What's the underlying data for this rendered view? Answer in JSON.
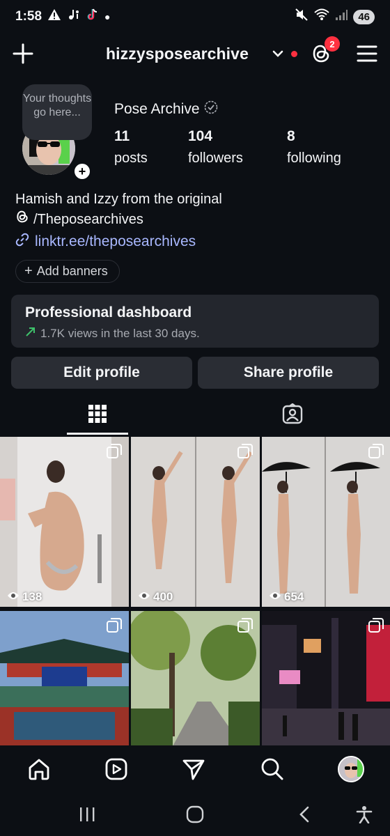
{
  "status_bar": {
    "time": "1:58",
    "battery": "46"
  },
  "header": {
    "username": "hizzysposearchive",
    "notification_count": "2"
  },
  "profile": {
    "thought_bubble": "Your thoughts go here...",
    "display_name": "Pose Archive",
    "stats": [
      {
        "value": "11",
        "label": "posts"
      },
      {
        "value": "104",
        "label": "followers"
      },
      {
        "value": "8",
        "label": "following"
      }
    ],
    "bio_line1": "Hamish and Izzy from the original",
    "bio_line2": "/Theposearchives",
    "link": "linktr.ee/theposearchives",
    "add_banners": "Add banners"
  },
  "dashboard": {
    "title": "Professional dashboard",
    "subtitle": "1.7K views in the last 30 days."
  },
  "buttons": {
    "edit": "Edit profile",
    "share": "Share profile"
  },
  "tabs": [
    {
      "icon": "grid-icon",
      "active": true
    },
    {
      "icon": "tagged-icon",
      "active": false
    }
  ],
  "grid": [
    {
      "views": "138",
      "colors": [
        "#e9e7e6",
        "#cfc9c6"
      ]
    },
    {
      "views": "400",
      "colors": [
        "#e2e0de",
        "#cbc7c4"
      ]
    },
    {
      "views": "654",
      "colors": [
        "#dedcda",
        "#c3c0bd"
      ]
    },
    {
      "views": "",
      "colors": [
        "#6c8fc0",
        "#b03a2e"
      ]
    },
    {
      "views": "",
      "colors": [
        "#8fb35a",
        "#3f5f2a"
      ]
    },
    {
      "views": "",
      "colors": [
        "#1c1a24",
        "#7a3b55"
      ]
    }
  ],
  "colors": {
    "accent_link": "#a9b8ff",
    "notification": "#ff3040",
    "growth": "#3ec26b"
  }
}
